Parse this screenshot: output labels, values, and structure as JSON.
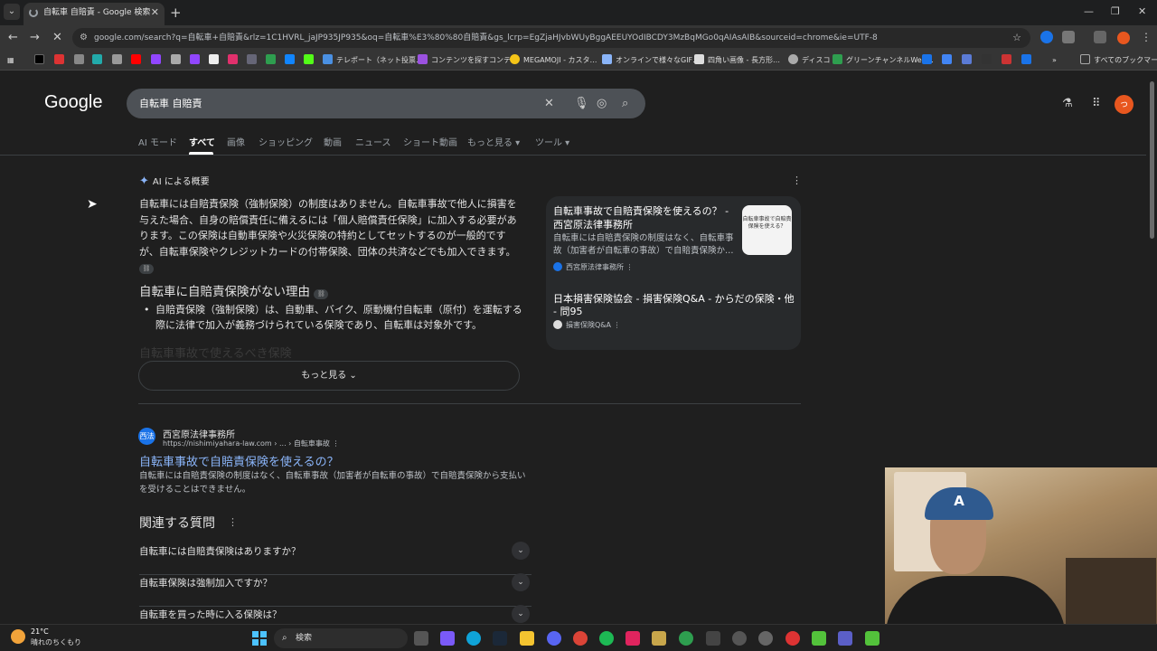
{
  "browser": {
    "tab_title": "自転車 自賠責 - Google 検索",
    "url": "google.com/search?q=自転車+自賠責&rlz=1C1HVRL_jaJP935JP935&oq=自転車%E3%80%80自賠責&gs_lcrp=EgZjaHJvbWUyBggAEEUYOdIBCDY3MzBqMGo0qAIAsAIB&sourceid=chrome&ie=UTF-8",
    "bookmarks": [
      {
        "label": "テレポート（ネット投票…",
        "color": "#4a90e2"
      },
      {
        "label": "コンテンツを探すコンテ…",
        "color": "#9b51e0"
      },
      {
        "label": "MEGAMOJI - カスタ…",
        "color": "#f5c518"
      },
      {
        "label": "オンラインで様々なGIF…",
        "color": "#8ab4f8"
      },
      {
        "label": "四角い画像 - 長方形…",
        "color": "#dddddd"
      },
      {
        "label": "ディスコ",
        "color": "#aaaaaa"
      },
      {
        "label": "グリーンチャンネルWeb…",
        "color": "#2e9e4f"
      },
      {
        "label": "すべてのブックマーク",
        "color": "#888888"
      }
    ]
  },
  "google": {
    "logo": "Google",
    "query": "自転車 自賠責",
    "tabs": [
      "AI モード",
      "すべて",
      "画像",
      "ショッピング",
      "動画",
      "ニュース",
      "ショート動画",
      "もっと見る ▾",
      "ツール ▾"
    ],
    "avatar_letter": "っ"
  },
  "ai_overview": {
    "heading": "AI による概要",
    "paragraph": "自転車には自賠責保険（強制保険）の制度はありません。自転車事故で他人に損害を与えた場合、自身の賠償責任に備えるには「個人賠償責任保険」に加入する必要があります。この保険は自動車保険や火災保険の特約としてセットするのが一般的ですが、自転車保険やクレジットカードの付帯保険、団体の共済などでも加入できます。",
    "subheading": "自転車に自賠責保険がない理由",
    "bullet": "自賠責保険（強制保険）は、自動車、バイク、原動機付自転車（原付）を運転する際に法律で加入が義務づけられている保険であり、自転車は対象外です。",
    "faded": "自転車事故で使えるべき保険",
    "more_button": "もっと見る",
    "sources": [
      {
        "title": "自転車事故で自賠責保険を使えるの？ - 西宮原法律事務所",
        "snippet": "自転車には自賠責保険の制度はなく、自転車事故（加害者が自転車の事故）で自賠責保険か…",
        "site": "西宮原法律事務所",
        "thumb_text": "自転車事故で自賠責保険を使える？"
      },
      {
        "title": "日本損害保険協会 - 損害保険Q&A - からだの保険・他 - 問95",
        "site": "損害保険Q&A"
      }
    ]
  },
  "result": {
    "favicon": "西法",
    "site": "西宮原法律事務所",
    "url": "https://nishimiyahara-law.com › ... › 自転車事故",
    "title": "自転車事故で自賠責保険を使えるの？",
    "snippet": "自転車には自賠責保険の制度はなく、自転車事故（加害者が自転車の事故）で自賠責保険から支払いを受けることはできません。"
  },
  "related": {
    "heading": "関連する質問",
    "questions": [
      "自転車には自賠責保険はありますか？",
      "自転車保険は強制加入ですか？",
      "自転車を買った時に入る保険は？"
    ]
  },
  "taskbar": {
    "temp": "21°C",
    "weather": "晴れのちくもり",
    "search_placeholder": "検索"
  }
}
